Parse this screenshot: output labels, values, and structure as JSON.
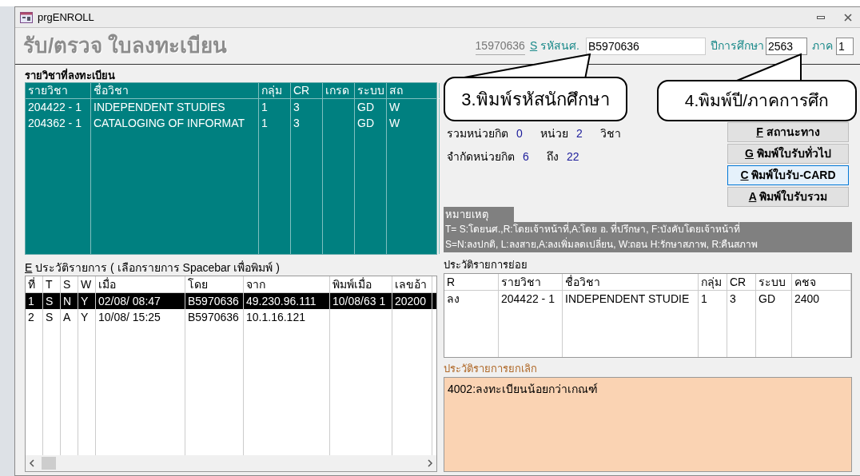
{
  "window": {
    "title": "prgENROLL"
  },
  "header": {
    "title": "รับ/ตรวจ ใบลงทะเบียน",
    "id_display": "15970636",
    "student_id": {
      "accel": "S",
      "label": "รหัสนศ.",
      "value": "B5970636"
    },
    "year": {
      "label": "ปีการศึกษา",
      "value": "2563"
    },
    "term": {
      "label": "ภาค",
      "value": "1"
    }
  },
  "registered": {
    "label": "รายวิชาที่ลงทะเบียน",
    "columns": [
      "รายวิชา",
      "ชื่อวิชา",
      "กลุ่ม",
      "CR",
      "เกรด",
      "ระบบ",
      "สถ"
    ],
    "rows": [
      [
        "204422 - 1",
        "INDEPENDENT STUDIES",
        "1",
        "3",
        "",
        "GD",
        "W"
      ],
      [
        "204362 - 1",
        "CATALOGING OF INFORMAT",
        "1",
        "3",
        "",
        "GD",
        "W"
      ]
    ]
  },
  "summary": [
    [
      {
        "kind": "label",
        "text": "รวมหน่วยกิต"
      },
      {
        "kind": "value",
        "text": "0"
      },
      {
        "kind": "label",
        "text": "หน่วย"
      },
      {
        "kind": "value",
        "text": "2"
      },
      {
        "kind": "label",
        "text": "วิชา"
      }
    ],
    [
      {
        "kind": "label",
        "text": "จำกัดหน่วยกิต"
      },
      {
        "kind": "value",
        "text": "6"
      },
      {
        "kind": "label",
        "text": "ถึง"
      },
      {
        "kind": "value",
        "text": "22"
      }
    ]
  ],
  "buttons": [
    {
      "accel": "F",
      "label": "สถานะทาง",
      "focused": false
    },
    {
      "accel": "G",
      "label": "พิมพ์ใบรับทั่วไป",
      "focused": false
    },
    {
      "accel": "C",
      "label": "พิมพ์ใบรับ-CARD",
      "focused": true
    },
    {
      "accel": "A",
      "label": "พิมพ์ใบรับรวม",
      "focused": false
    }
  ],
  "notes": {
    "title": "หมายเหตุ",
    "lines": [
      "T= S:โดยนศ.,R:โดยเจ้าหน้าที่,A:โดย อ. ที่ปรึกษา, F:บังคับโดยเจ้าหน้าที่",
      "S=N:ลงปกติ, L:ลงสาย,A:ลงเพิ่มลดเปลี่ยน, W:ถอน H:รักษาสภาพ, R:คืนสภาพ"
    ]
  },
  "history": {
    "accel": "E",
    "label": "ประวัติรายการ ( เลือกรายการ Spacebar เพื่อพิมพ์ )",
    "columns": [
      "ที่",
      "T",
      "S",
      "W",
      "เมื่อ",
      "โดย",
      "จาก",
      "พิมพ์เมื่อ",
      "เลขอ้า"
    ],
    "rows": [
      {
        "selected": true,
        "cells": [
          "1",
          "S",
          "N",
          "Y",
          "02/08/ 08:47",
          "B5970636",
          "49.230.96.111",
          "10/08/63 1",
          "20200"
        ]
      },
      {
        "selected": false,
        "cells": [
          "2",
          "S",
          "A",
          "Y",
          "10/08/ 15:25",
          "B5970636",
          "10.1.16.121",
          "",
          ""
        ]
      }
    ]
  },
  "details": {
    "label": "ประวัติรายการย่อย",
    "columns": [
      "R",
      "รายวิชา",
      "ชื่อวิชา",
      "กลุ่ม",
      "CR",
      "ระบบ",
      "คชจ"
    ],
    "rows": [
      [
        "ลง",
        "204422 - 1",
        "INDEPENDENT STUDIE",
        "1",
        "3",
        "GD",
        "2400"
      ]
    ]
  },
  "cancellations": {
    "label": "ประวัติรายการยกเลิก",
    "text": "4002:ลงทะเบียนน้อยกว่าเกณฑ์"
  },
  "callouts": [
    {
      "text": "3.พิมพ์รหัสนักศึกษา"
    },
    {
      "text": "4.พิมพ์ปี/ภาคการศึก"
    }
  ]
}
